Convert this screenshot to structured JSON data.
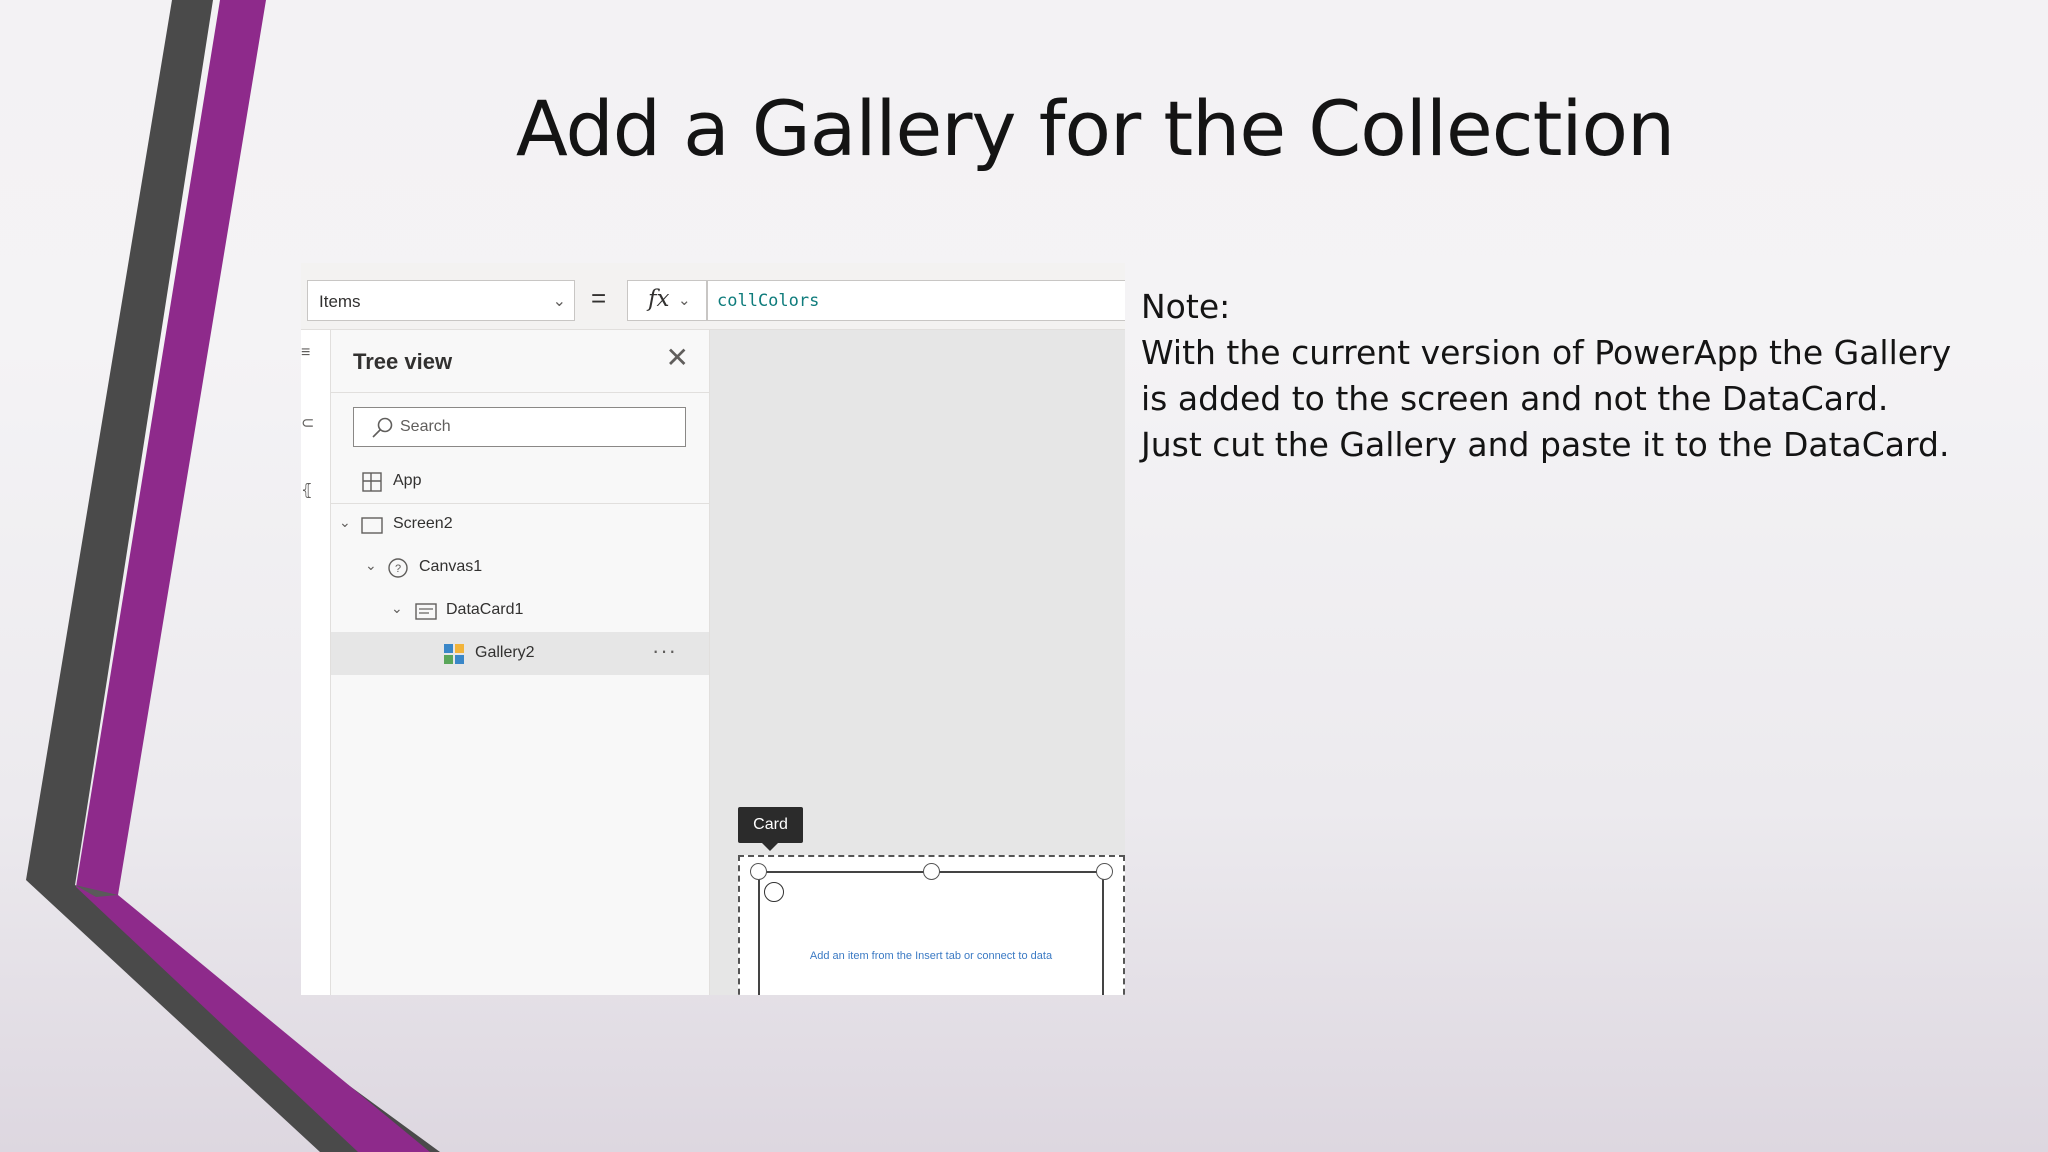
{
  "slide": {
    "title": "Add a Gallery for the Collection",
    "note_lines": [
      "Note:",
      "With the current version of PowerApp the Gallery",
      "is added to the screen and not the DataCard.",
      "Just cut the Gallery and paste it to the DataCard."
    ]
  },
  "colors": {
    "accent_purple": "#8e2a8b",
    "accent_gray": "#4a4a4a",
    "formula_text": "#0f7c7c"
  },
  "formula_bar": {
    "property": "Items",
    "equals": "=",
    "fx_label": "fx",
    "formula": "collColors"
  },
  "tree_view": {
    "title": "Tree view",
    "search_placeholder": "Search",
    "items": [
      {
        "label": "App",
        "icon": "app-icon"
      },
      {
        "label": "Screen2",
        "icon": "screen-icon"
      },
      {
        "label": "Canvas1",
        "icon": "canvas-icon"
      },
      {
        "label": "DataCard1",
        "icon": "datacard-icon"
      },
      {
        "label": "Gallery2",
        "icon": "gallery-icon",
        "selected": true
      }
    ],
    "more_label": "···"
  },
  "canvas": {
    "tooltip": "Card",
    "gallery_message": "Add an item from the Insert tab or connect to data"
  }
}
